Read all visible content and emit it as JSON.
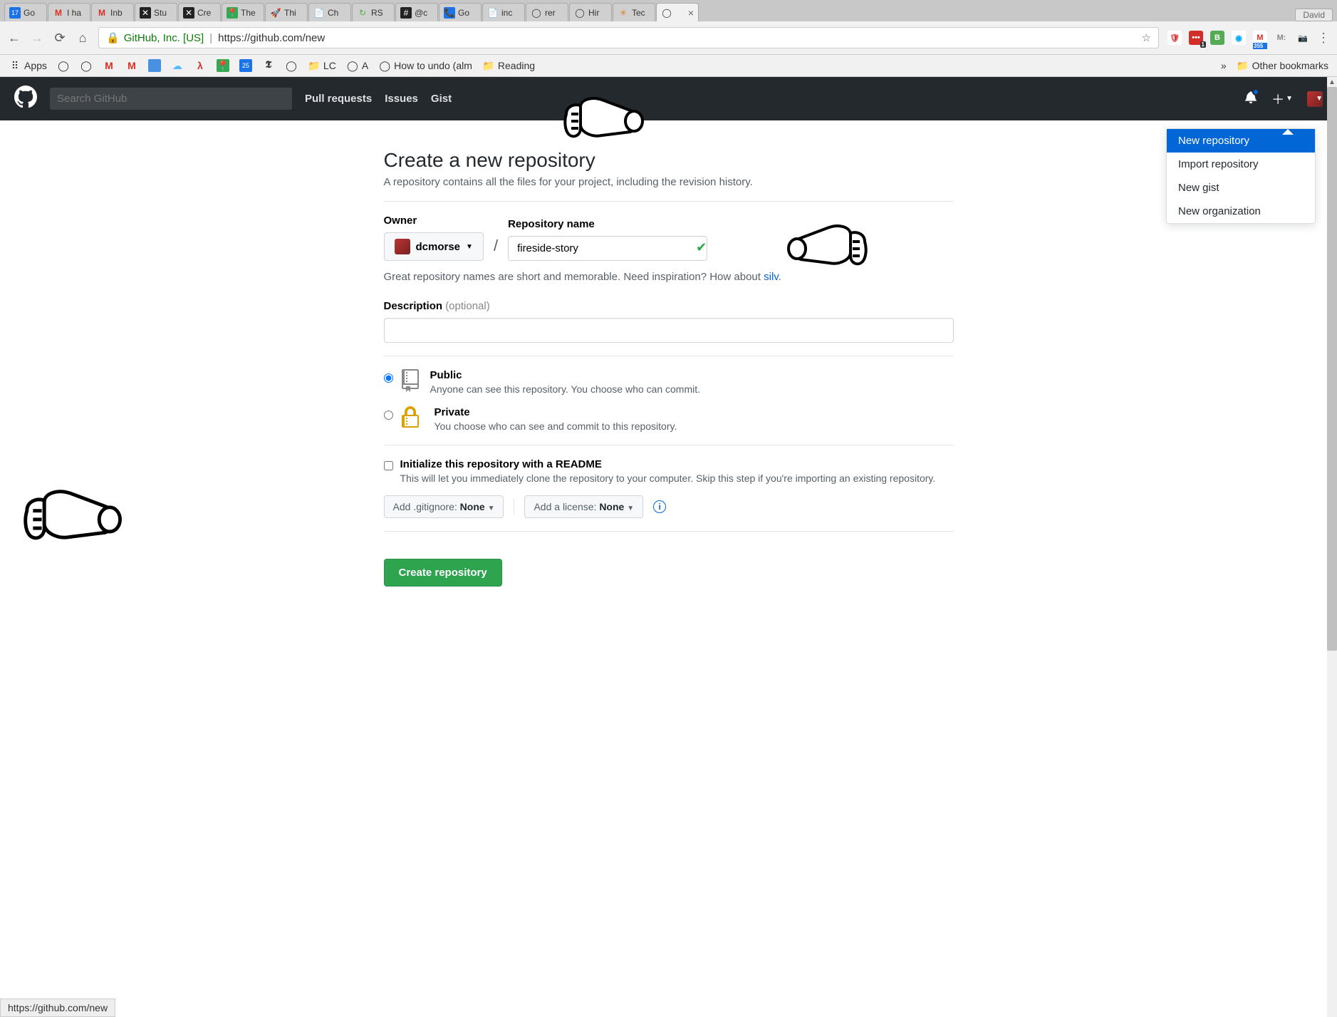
{
  "browser": {
    "user": "David",
    "tabs": [
      {
        "label": "Go",
        "favicon_bg": "#1a73e8",
        "favicon_text": "17"
      },
      {
        "label": "I ha",
        "favicon_bg": "#fff",
        "favicon_text": "M",
        "favicon_color": "#d93025"
      },
      {
        "label": "Inb",
        "favicon_bg": "#fff",
        "favicon_text": "M",
        "favicon_color": "#d93025"
      },
      {
        "label": "Stu",
        "favicon_bg": "#222",
        "favicon_text": "✕"
      },
      {
        "label": "Cre",
        "favicon_bg": "#222",
        "favicon_text": "✕"
      },
      {
        "label": "The",
        "favicon_bg": "#34a853",
        "favicon_text": "📍"
      },
      {
        "label": "Thi",
        "favicon_bg": "#fff",
        "favicon_text": "🚀"
      },
      {
        "label": "Ch",
        "favicon_bg": "#fff",
        "favicon_text": "📄"
      },
      {
        "label": "RS",
        "favicon_bg": "#fff",
        "favicon_text": "↻",
        "favicon_color": "#5a5"
      },
      {
        "label": "@c",
        "favicon_bg": "#222",
        "favicon_text": "#"
      },
      {
        "label": "Go",
        "favicon_bg": "#1a73e8",
        "favicon_text": "📞"
      },
      {
        "label": "inc",
        "favicon_bg": "#fff",
        "favicon_text": "📄"
      },
      {
        "label": "rer",
        "favicon_bg": "#fff",
        "favicon_text": "◯"
      },
      {
        "label": "Hir",
        "favicon_bg": "#fff",
        "favicon_text": "◯"
      },
      {
        "label": "Tec",
        "favicon_bg": "#fff",
        "favicon_text": "✳",
        "favicon_color": "#e67e22"
      }
    ],
    "active_tab_favicon": "◯",
    "url_origin": "GitHub, Inc. [US]",
    "url_path": "https://github.com/new",
    "bookmarks": {
      "apps": "Apps",
      "items": [
        "LC",
        "A",
        "How to undo (alm",
        "Reading"
      ],
      "overflow": "»",
      "other": "Other bookmarks"
    },
    "gmail_badge": "355",
    "lastpass_badge": "1",
    "cal_badge": "25"
  },
  "github": {
    "search_placeholder": "Search GitHub",
    "nav": {
      "pull": "Pull requests",
      "issues": "Issues",
      "gist": "Gist"
    },
    "dropdown": {
      "new_repo": "New repository",
      "import_repo": "Import repository",
      "new_gist": "New gist",
      "new_org": "New organization"
    }
  },
  "page": {
    "title": "Create a new repository",
    "subtitle": "A repository contains all the files for your project, including the revision history.",
    "owner_label": "Owner",
    "repo_label": "Repository name",
    "owner": "dcmorse",
    "repo_name": "fireside-story",
    "hint_prefix": "Great repository names are short and memorable. Need inspiration? How about ",
    "hint_suggestion": "silv",
    "hint_suffix": ".",
    "desc_label": "Description",
    "optional": "(optional)",
    "public": {
      "title": "Public",
      "desc": "Anyone can see this repository. You choose who can commit."
    },
    "private": {
      "title": "Private",
      "desc": "You choose who can see and commit to this repository."
    },
    "readme": {
      "title": "Initialize this repository with a README",
      "desc": "This will let you immediately clone the repository to your computer. Skip this step if you're importing an existing repository."
    },
    "gitignore_label": "Add .gitignore: ",
    "gitignore_value": "None",
    "license_label": "Add a license: ",
    "license_value": "None",
    "create": "Create repository"
  },
  "status": "https://github.com/new"
}
